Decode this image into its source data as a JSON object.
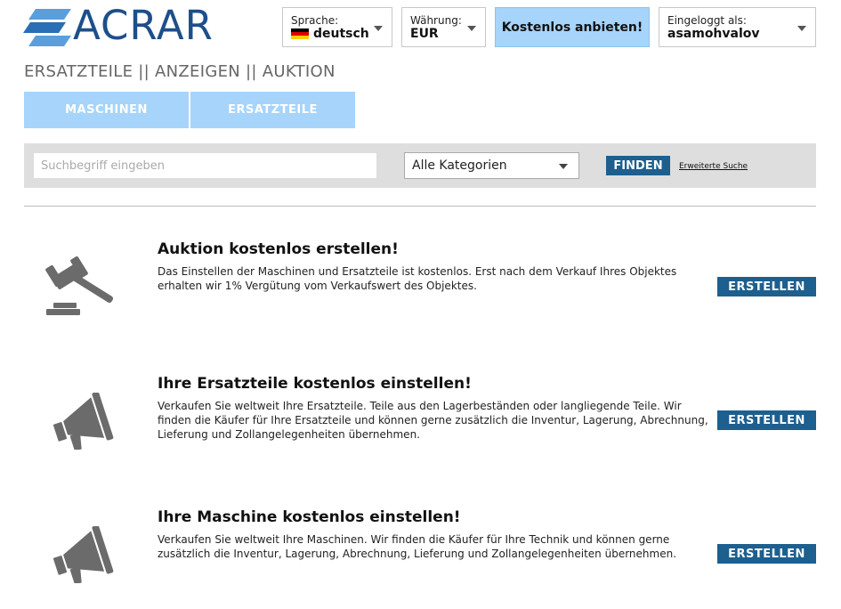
{
  "header": {
    "logo_text": "ACRAR",
    "language": {
      "label": "Sprache:",
      "value": "deutsch"
    },
    "currency": {
      "label": "Währung:",
      "value": "EUR"
    },
    "offer_button": "Kostenlos anbieten!",
    "account": {
      "label": "Eingeloggt als:",
      "value": "asamohvalov"
    }
  },
  "sections_title": "ERSATZTEILE || ANZEIGEN || AUKTION",
  "tabs": [
    {
      "label": "MASCHINEN"
    },
    {
      "label": "ERSATZTEILE"
    }
  ],
  "search": {
    "placeholder": "Suchbegriff eingeben",
    "category": "Alle Kategorien",
    "find_button": "FINDEN",
    "advanced_link": "Erweiterte Suche"
  },
  "promos": [
    {
      "icon": "gavel-icon",
      "title": "Auktion kostenlos erstellen!",
      "description": "Das Einstellen der Maschinen und Ersatzteile ist kostenlos. Erst nach dem Verkauf Ihres Objektes erhalten wir 1% Vergütung vom Verkaufswert des Objektes.",
      "button": "ERSTELLEN"
    },
    {
      "icon": "megaphone-icon",
      "title": "Ihre Ersatzteile kostenlos einstellen!",
      "description": "Verkaufen Sie weltweit Ihre Ersatzteile. Teile aus den Lagerbeständen oder langliegende Teile. Wir finden die Käufer für Ihre Ersatzteile und können gerne zusätzlich die Inventur, Lagerung, Abrechnung, Lieferung und Zollangelegenheiten übernehmen.",
      "button": "ERSTELLEN"
    },
    {
      "icon": "megaphone-icon",
      "title": "Ihre Maschine kostenlos einstellen!",
      "description": "Verkaufen Sie weltweit Ihre Maschinen. Wir finden die Käufer für Ihre Technik und können gerne zusätzlich die Inventur, Lagerung, Abrechnung, Lieferung und Zollangelegenheiten übernehmen.",
      "button": "ERSTELLEN"
    }
  ],
  "colors": {
    "brand_blue": "#1d4f8a",
    "light_blue": "#a6d4fa",
    "button_blue": "#1d5f8f",
    "icon_gray": "#6b6b6b"
  }
}
